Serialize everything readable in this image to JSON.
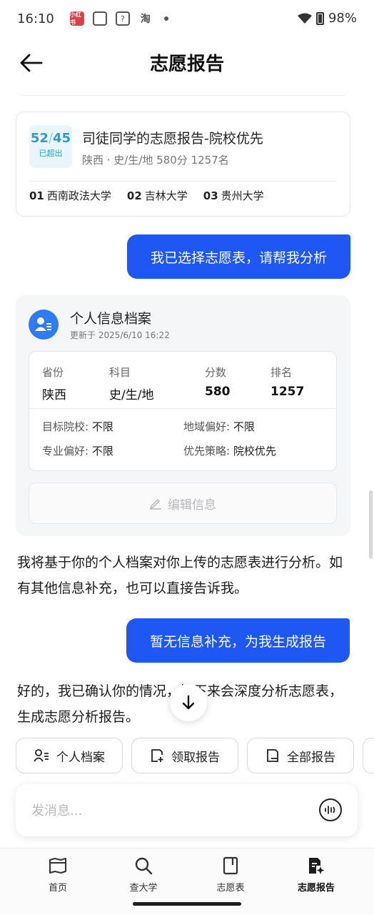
{
  "status_bar": {
    "time": "16:10",
    "apps": [
      "小红书",
      "☐",
      "?",
      "淘"
    ],
    "battery": "98%"
  },
  "header": {
    "title": "志愿报告"
  },
  "report_card": {
    "score_value": "52",
    "score_total": "45",
    "exceed_label": "已超出",
    "title": "司徒同学的志愿报告-院校优先",
    "subtitle": "陕西 · 史/生/地 580分 1257名",
    "schools": [
      {
        "num": "01",
        "name": "西南政法大学"
      },
      {
        "num": "02",
        "name": "吉林大学"
      },
      {
        "num": "03",
        "name": "贵州大学"
      }
    ]
  },
  "chat": {
    "user_msg_1": "我已选择志愿表，请帮我分析",
    "profile": {
      "title": "个人信息档案",
      "updated": "更新于 2025/6/10 16:22",
      "province_label": "省份",
      "province": "陕西",
      "subject_label": "科目",
      "subject": "史/生/地",
      "score_label": "分数",
      "score": "580",
      "rank_label": "排名",
      "rank": "1257",
      "target_school_label": "目标院校:",
      "target_school": "不限",
      "region_label": "地域偏好:",
      "region": "不限",
      "major_label": "专业偏好:",
      "major": "不限",
      "strategy_label": "优先策略:",
      "strategy": "院校优先",
      "edit_label": "编辑信息"
    },
    "ai_msg_1": "我将基于你的个人档案对你上传的志愿表进行分析。如有其他信息补充，也可以直接告诉我。",
    "user_msg_2": "暂无信息补充，为我生成报告",
    "ai_msg_2": "好的，我已确认你的情况，接下来会深度分析志愿表，生成志愿分析报告。"
  },
  "quick_actions": [
    {
      "label": "个人档案"
    },
    {
      "label": "领取报告"
    },
    {
      "label": "全部报告"
    }
  ],
  "input": {
    "placeholder": "发消息..."
  },
  "bottom_nav": [
    {
      "label": "首页"
    },
    {
      "label": "查大学"
    },
    {
      "label": "志愿表"
    },
    {
      "label": "志愿报告"
    }
  ],
  "colors": {
    "accent": "#1f57f5",
    "score": "#2d9bc4"
  }
}
